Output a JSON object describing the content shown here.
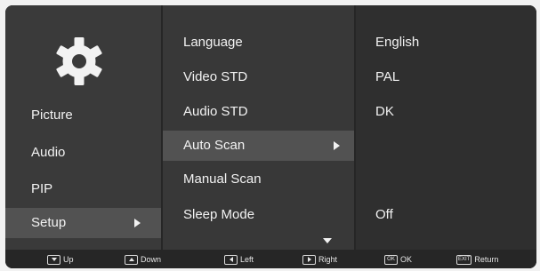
{
  "main_menu": {
    "icon": "gear-icon",
    "items": [
      {
        "label": "Picture"
      },
      {
        "label": "Audio"
      },
      {
        "label": "PIP"
      },
      {
        "label": "Setup",
        "selected": true
      }
    ]
  },
  "setup_menu": {
    "items": [
      {
        "label": "Language",
        "value": "English"
      },
      {
        "label": "Video STD",
        "value": "PAL"
      },
      {
        "label": "Audio STD",
        "value": "DK"
      },
      {
        "label": "Auto Scan",
        "value": "",
        "selected": true
      },
      {
        "label": "Manual Scan",
        "value": ""
      },
      {
        "label": "Sleep Mode",
        "value": "Off"
      }
    ],
    "more_below": true
  },
  "footer": {
    "hints": [
      {
        "key": "",
        "icon": "triangle-down-icon",
        "label": "Up"
      },
      {
        "key": "",
        "icon": "triangle-up-icon",
        "label": "Down"
      },
      {
        "key": "",
        "icon": "triangle-left-icon",
        "label": "Left"
      },
      {
        "key": "",
        "icon": "triangle-right-icon",
        "label": "Right"
      },
      {
        "key": "OK",
        "icon": "",
        "label": "OK"
      },
      {
        "key": "EXIT",
        "icon": "",
        "label": "Return"
      }
    ]
  },
  "colors": {
    "background": "#262626",
    "main_column": "#3a3a3a",
    "sub_column": "#383838",
    "value_column": "#2f2f2f",
    "highlight": "#525252",
    "text": "#f2f2f2"
  }
}
